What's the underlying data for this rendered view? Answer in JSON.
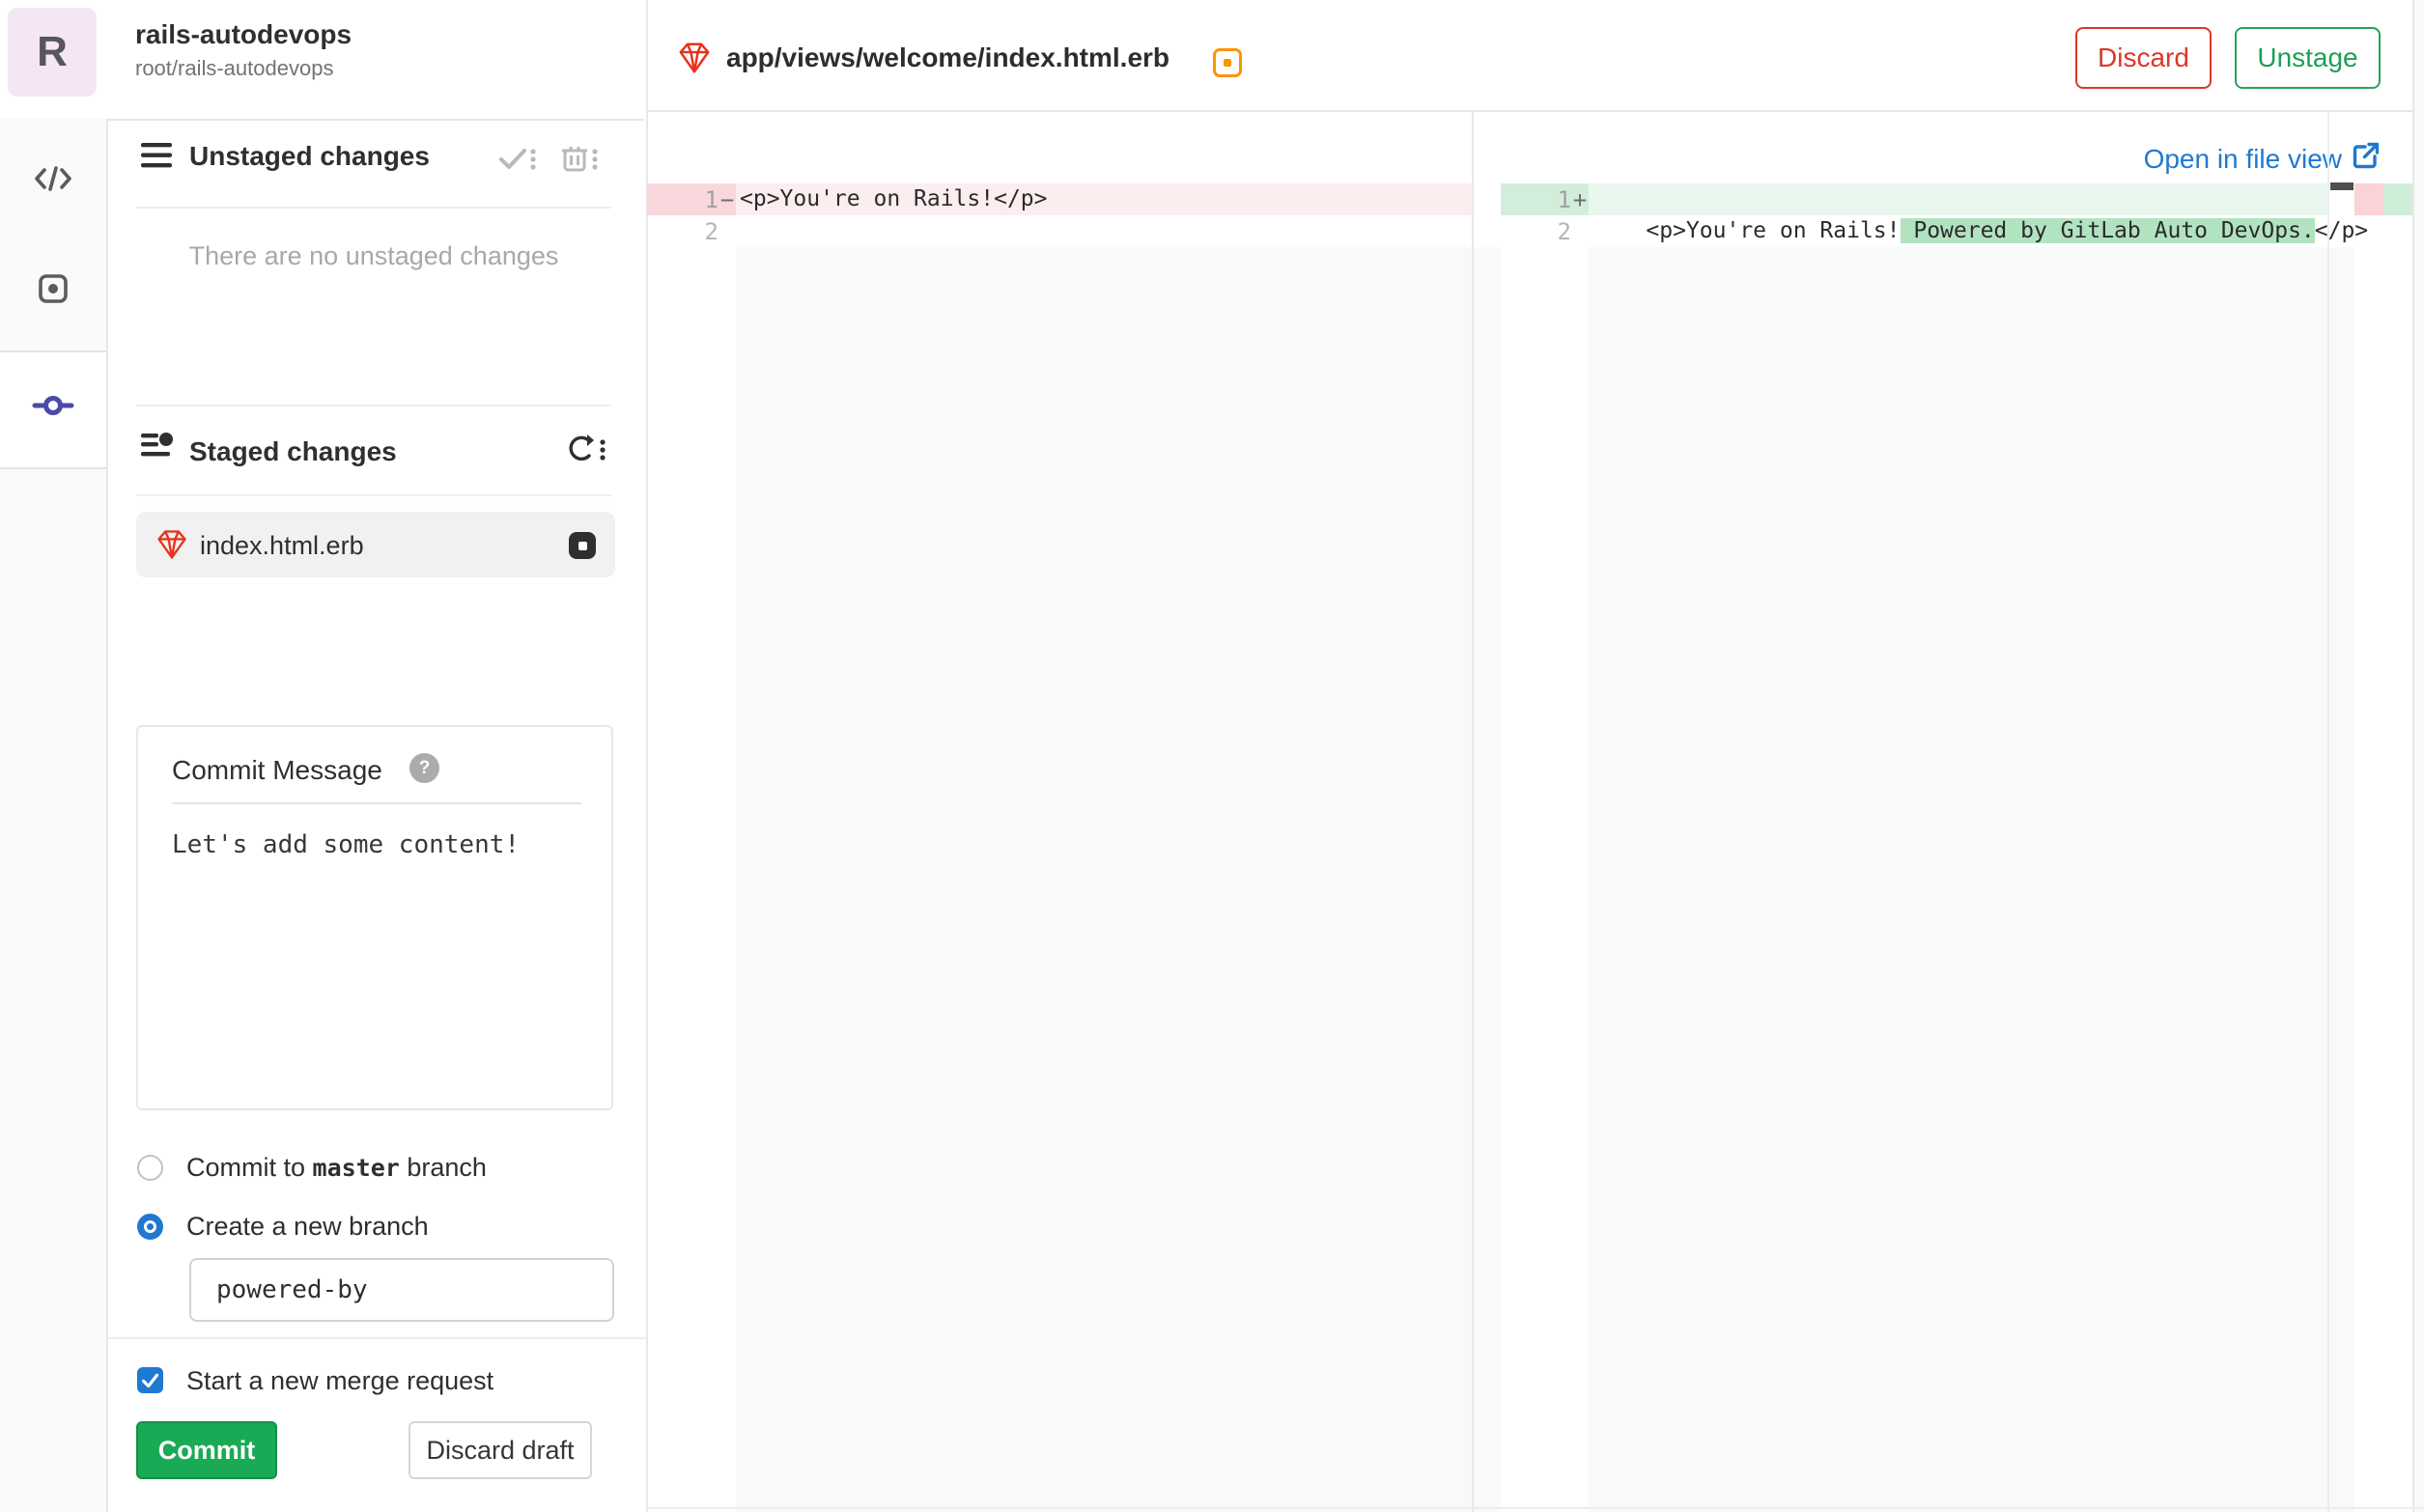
{
  "colors": {
    "accent_blue": "#1f78d1",
    "success_green": "#1aaa55",
    "danger_red": "#db3b21",
    "warning_orange": "#fc9403",
    "diff_removed_line_bg": "#fcedef",
    "diff_removed_gutter_bg": "#f8d8dc",
    "diff_added_line_bg": "#e9f7ee",
    "diff_added_gutter_bg": "#d2eedb",
    "diff_added_word_bg": "#b2e3c0"
  },
  "project": {
    "avatar_letter": "R",
    "name": "rails-autodevops",
    "path": "root/rails-autodevops"
  },
  "sidebar": {
    "unstaged": {
      "title": "Unstaged changes",
      "empty_message": "There are no unstaged changes"
    },
    "staged": {
      "title": "Staged changes",
      "files": [
        {
          "name": "index.html.erb"
        }
      ]
    },
    "commit": {
      "message_label": "Commit Message",
      "help_glyph": "?",
      "message_value": "Let's add some content!",
      "option_master_prefix": "Commit to ",
      "option_master_branch": "master",
      "option_master_suffix": " branch",
      "option_new_branch": "Create a new branch",
      "branch_name": "powered-by",
      "merge_request_label": "Start a new merge request",
      "commit_button": "Commit",
      "discard_draft_button": "Discard draft"
    }
  },
  "editor": {
    "file_path": "app/views/welcome/index.html.erb",
    "discard_button": "Discard",
    "unstage_button": "Unstage",
    "open_in_file_view": "Open in file view"
  },
  "diff": {
    "left_pane": {
      "rows": [
        {
          "number": "1",
          "sign": "−",
          "code": "<p>You're on Rails!</p>"
        },
        {
          "number": "2",
          "sign": "",
          "code": ""
        }
      ]
    },
    "right_pane": {
      "rows": [
        {
          "number": "1",
          "sign": "+",
          "code_before": "<p>You're on Rails!",
          "code_added": " Powered by GitLab Auto DevOps.",
          "code_after": "</p>"
        },
        {
          "number": "2",
          "sign": "",
          "code_before": "",
          "code_added": "",
          "code_after": ""
        }
      ]
    }
  }
}
